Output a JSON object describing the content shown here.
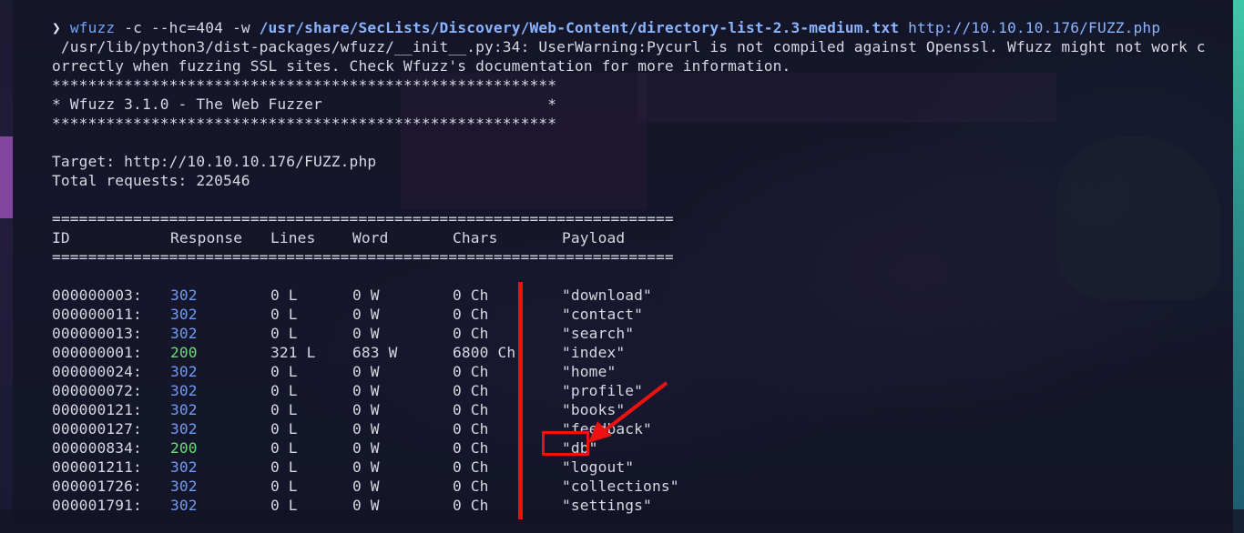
{
  "command": {
    "prompt_symbol": "❯",
    "program": "wfuzz",
    "flags": " -c --hc=404 -w ",
    "wordlist": "/usr/share/SecLists/Discovery/Web-Content/directory-list-2.3-medium.txt",
    "target_url": " http://10.10.10.176/FUZZ.php"
  },
  "warning": {
    "line1": " /usr/lib/python3/dist-packages/wfuzz/__init__.py:34: UserWarning:Pycurl is not compiled against Openssl. Wfuzz might not work c",
    "line2": "orrectly when fuzzing SSL sites. Check Wfuzz's documentation for more information."
  },
  "banner": {
    "stars": "********************************************************",
    "title": "* Wfuzz 3.1.0 - The Web Fuzzer                         *"
  },
  "target_line": "Target: http://10.10.10.176/FUZZ.php",
  "total_requests": "Total requests: 220546",
  "separator": "=====================================================================",
  "headers": {
    "id": "ID",
    "response": "Response",
    "lines": "Lines",
    "word": "Word",
    "chars": "Chars",
    "payload": "Payload"
  },
  "rows": [
    {
      "id": "000000003:",
      "response": "302",
      "lines": "0 L",
      "word": "0 W",
      "chars": "0 Ch",
      "payload": "\"download\""
    },
    {
      "id": "000000011:",
      "response": "302",
      "lines": "0 L",
      "word": "0 W",
      "chars": "0 Ch",
      "payload": "\"contact\""
    },
    {
      "id": "000000013:",
      "response": "302",
      "lines": "0 L",
      "word": "0 W",
      "chars": "0 Ch",
      "payload": "\"search\""
    },
    {
      "id": "000000001:",
      "response": "200",
      "lines": "321 L",
      "word": "683 W",
      "chars": "6800 Ch",
      "payload": "\"index\""
    },
    {
      "id": "000000024:",
      "response": "302",
      "lines": "0 L",
      "word": "0 W",
      "chars": "0 Ch",
      "payload": "\"home\""
    },
    {
      "id": "000000072:",
      "response": "302",
      "lines": "0 L",
      "word": "0 W",
      "chars": "0 Ch",
      "payload": "\"profile\""
    },
    {
      "id": "000000121:",
      "response": "302",
      "lines": "0 L",
      "word": "0 W",
      "chars": "0 Ch",
      "payload": "\"books\""
    },
    {
      "id": "000000127:",
      "response": "302",
      "lines": "0 L",
      "word": "0 W",
      "chars": "0 Ch",
      "payload": "\"feedback\""
    },
    {
      "id": "000000834:",
      "response": "200",
      "lines": "0 L",
      "word": "0 W",
      "chars": "0 Ch",
      "payload": "\"db\""
    },
    {
      "id": "000001211:",
      "response": "302",
      "lines": "0 L",
      "word": "0 W",
      "chars": "0 Ch",
      "payload": "\"logout\""
    },
    {
      "id": "000001726:",
      "response": "302",
      "lines": "0 L",
      "word": "0 W",
      "chars": "0 Ch",
      "payload": "\"collections\""
    },
    {
      "id": "000001791:",
      "response": "302",
      "lines": "0 L",
      "word": "0 W",
      "chars": "0 Ch",
      "payload": "\"settings\""
    }
  ],
  "colors": {
    "status_200": "#6cdc78",
    "status_302": "#6f9cf5",
    "annotation": "#ee1111"
  }
}
